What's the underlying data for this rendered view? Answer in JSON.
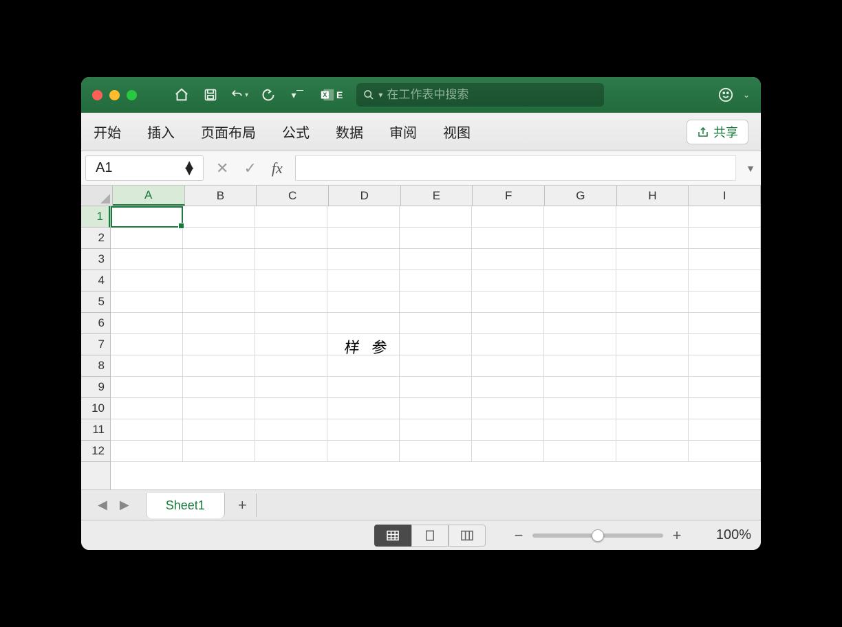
{
  "titlebar": {
    "search_placeholder": "在工作表中搜索",
    "app_label": "E"
  },
  "ribbon": {
    "tabs": [
      "开始",
      "插入",
      "页面布局",
      "公式",
      "数据",
      "审阅",
      "视图"
    ],
    "share_label": "共享"
  },
  "formula": {
    "namebox": "A1",
    "fx_label": "fx",
    "value": ""
  },
  "grid": {
    "columns": [
      "A",
      "B",
      "C",
      "D",
      "E",
      "F",
      "G",
      "H",
      "I"
    ],
    "rows": [
      "1",
      "2",
      "3",
      "4",
      "5",
      "6",
      "7",
      "8",
      "9",
      "10",
      "11",
      "12"
    ],
    "active_col": "A",
    "active_row": "1",
    "wordart_text": "样  参"
  },
  "sheets": {
    "active": "Sheet1"
  },
  "status": {
    "zoom": "100%"
  }
}
